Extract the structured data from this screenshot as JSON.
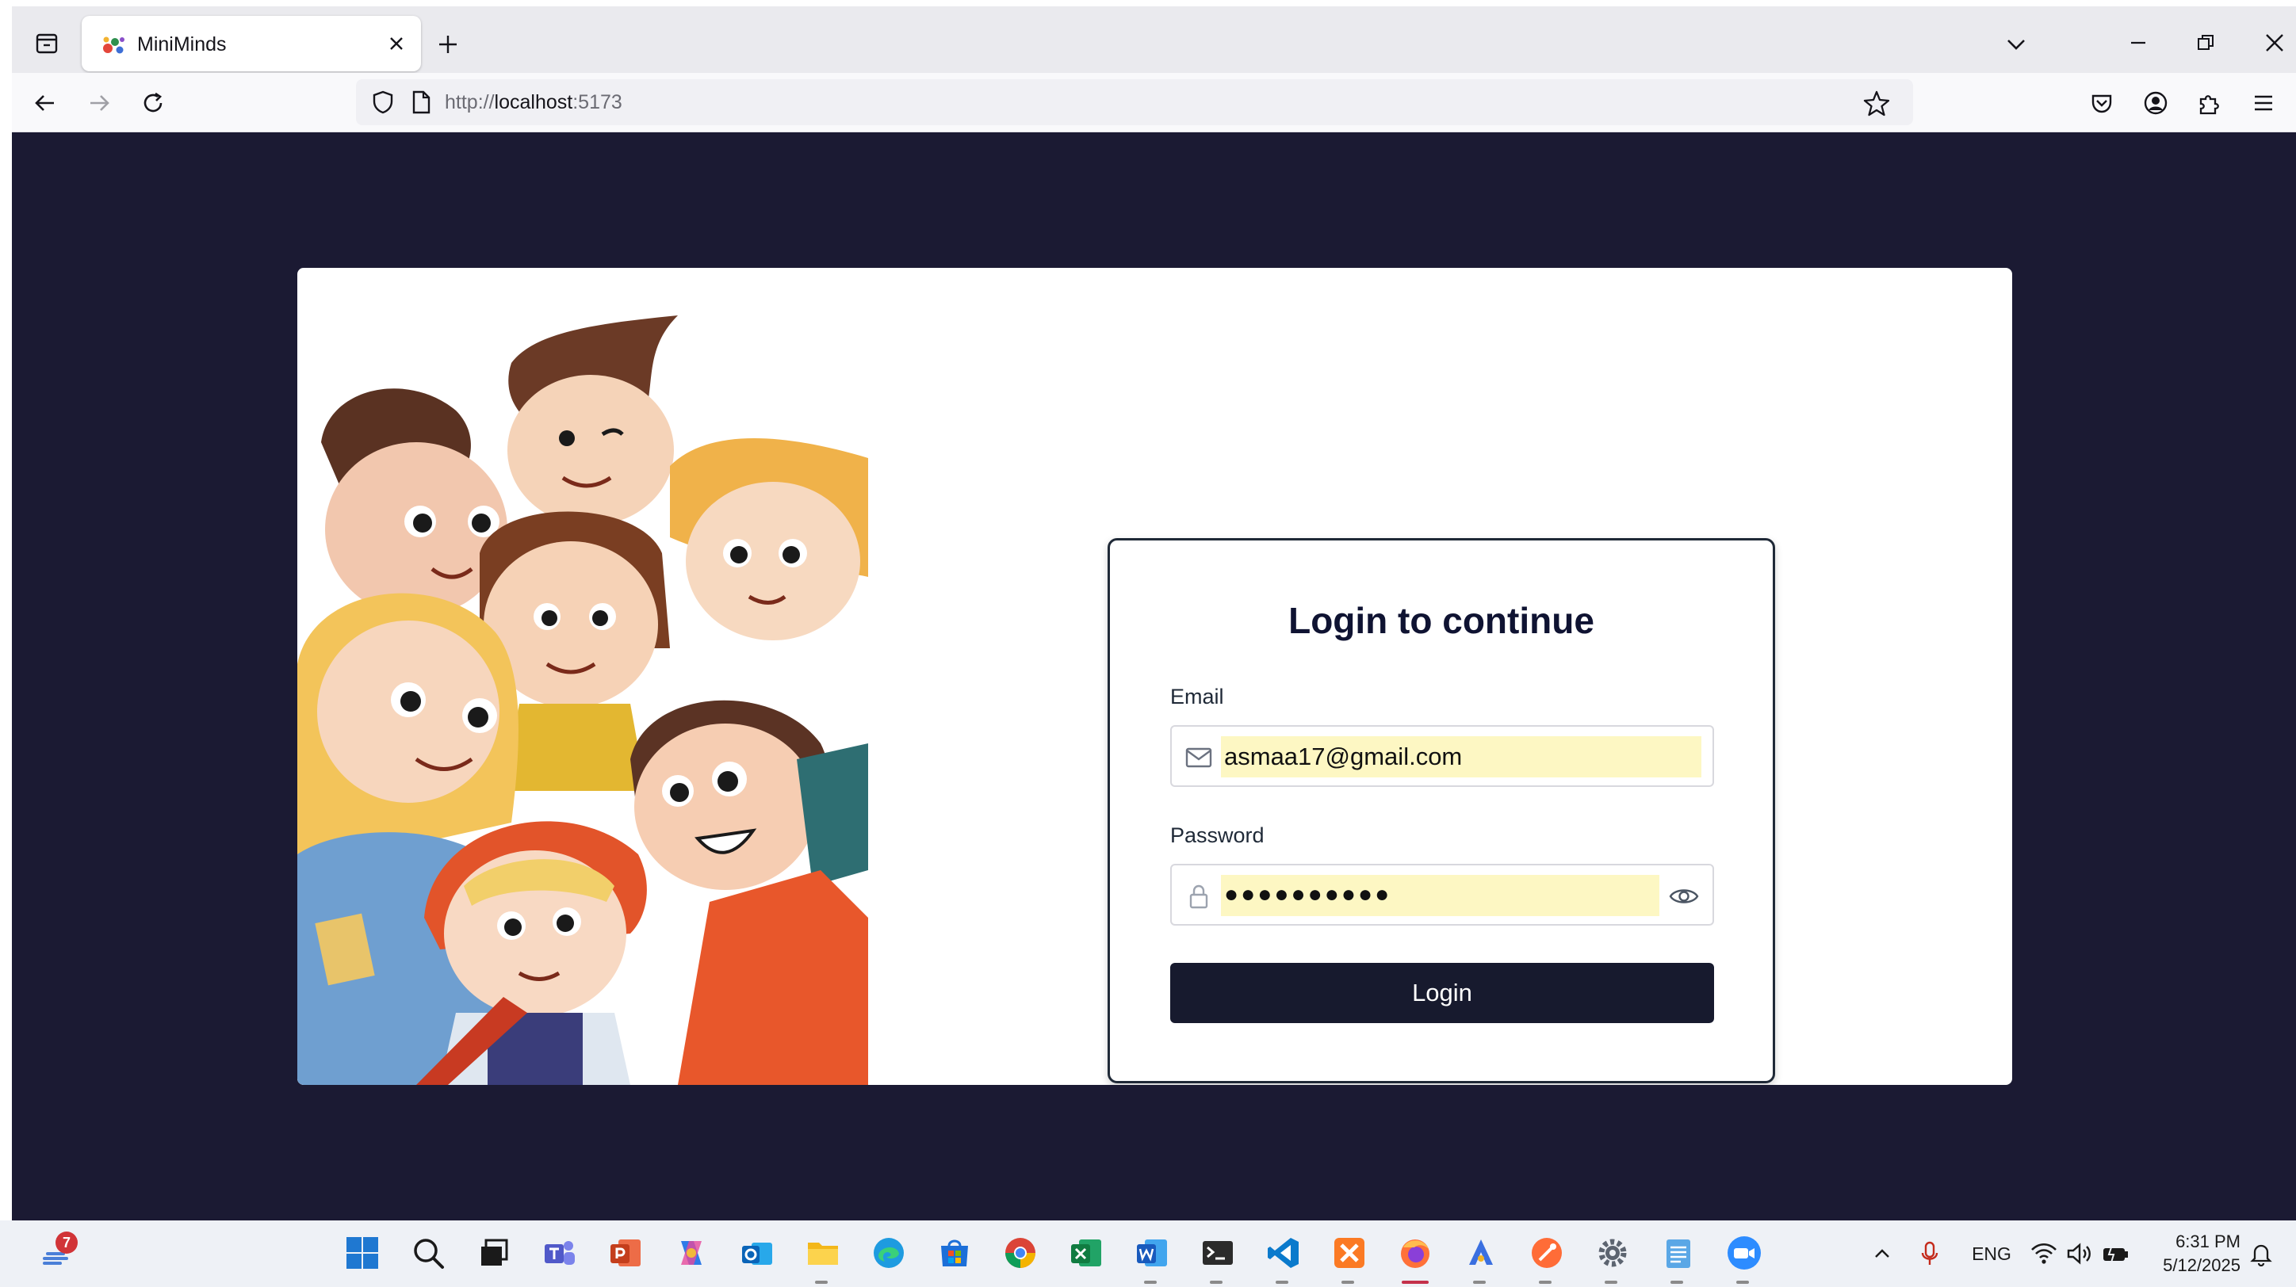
{
  "browser": {
    "tab": {
      "title": "MiniMinds"
    },
    "url": {
      "prefix": "http://",
      "host": "localhost",
      "suffix": ":5173"
    }
  },
  "login": {
    "title": "Login to continue",
    "email_label": "Email",
    "email_value": "asmaa17@gmail.com",
    "password_label": "Password",
    "password_masked": "●●●●●●●●●●",
    "button_label": "Login"
  },
  "taskbar": {
    "notification_count": "7",
    "apps": [
      "start",
      "search",
      "task-view",
      "teams",
      "powerpoint",
      "copilot",
      "outlook",
      "file-explorer",
      "edge",
      "store",
      "chrome",
      "excel",
      "word",
      "terminal",
      "vscode",
      "xampp",
      "firefox",
      "app-builder",
      "postman",
      "settings",
      "notepad",
      "zoom"
    ],
    "tray": {
      "language": "ENG"
    },
    "clock": {
      "time": "6:31 PM",
      "date": "5/12/2025"
    }
  },
  "colors": {
    "page_background": "#1b1a33",
    "button_background": "#171a2e",
    "autofill_highlight": "#fdf7c3"
  }
}
